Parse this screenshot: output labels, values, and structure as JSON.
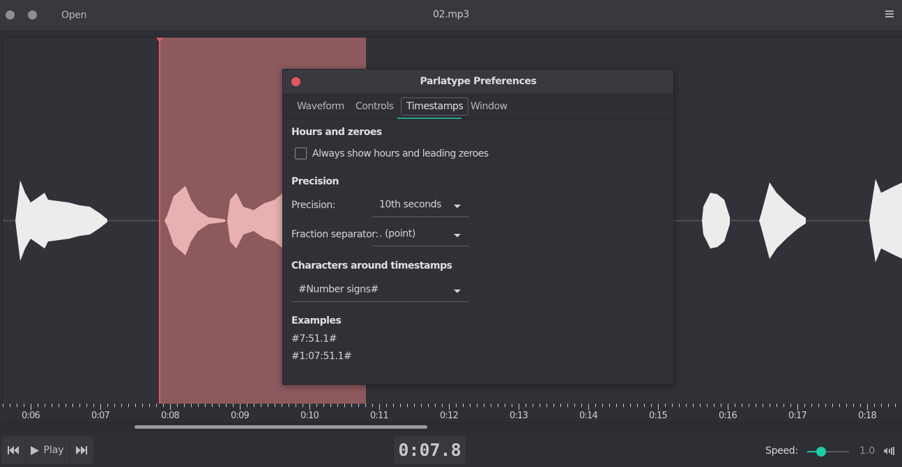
{
  "headerbar": {
    "open_label": "Open",
    "title": "02.mp3",
    "menu_icon": "hamburger-menu-icon"
  },
  "waveform": {
    "selection_color": "#8c5a5e",
    "cursor_color": "#e05b60"
  },
  "ruler": {
    "labels": [
      "0:06",
      "0:07",
      "0:08",
      "0:09",
      "0:10",
      "0:11",
      "0:12",
      "0:13",
      "0:14",
      "0:15",
      "0:16",
      "0:17",
      "0:18"
    ]
  },
  "transport": {
    "prev_icon": "skip-back-icon",
    "play_label": "Play",
    "play_icon": "play-icon",
    "next_icon": "skip-forward-icon"
  },
  "time_display": "0:07.8",
  "speed": {
    "label": "Speed:",
    "value": "1.0",
    "slider_fraction": 0.33,
    "accent_color": "#1ccfa3"
  },
  "dialog": {
    "title": "Parlatype Preferences",
    "tabs": [
      {
        "label": "Waveform",
        "active": false
      },
      {
        "label": "Controls",
        "active": false
      },
      {
        "label": "Timestamps",
        "active": true
      },
      {
        "label": "Window",
        "active": false
      }
    ],
    "sections": {
      "hours": {
        "heading": "Hours and zeroes",
        "checkbox_label": "Always show hours and leading zeroes",
        "checked": false
      },
      "precision": {
        "heading": "Precision",
        "precision_label": "Precision:",
        "precision_value": "10th seconds",
        "separator_label": "Fraction separator:",
        "separator_value": ". (point)"
      },
      "characters": {
        "heading": "Characters around timestamps",
        "value": "#Number signs#"
      },
      "examples": {
        "heading": "Examples",
        "items": [
          "#7:51.1#",
          "#1:07:51.1#"
        ]
      }
    }
  }
}
